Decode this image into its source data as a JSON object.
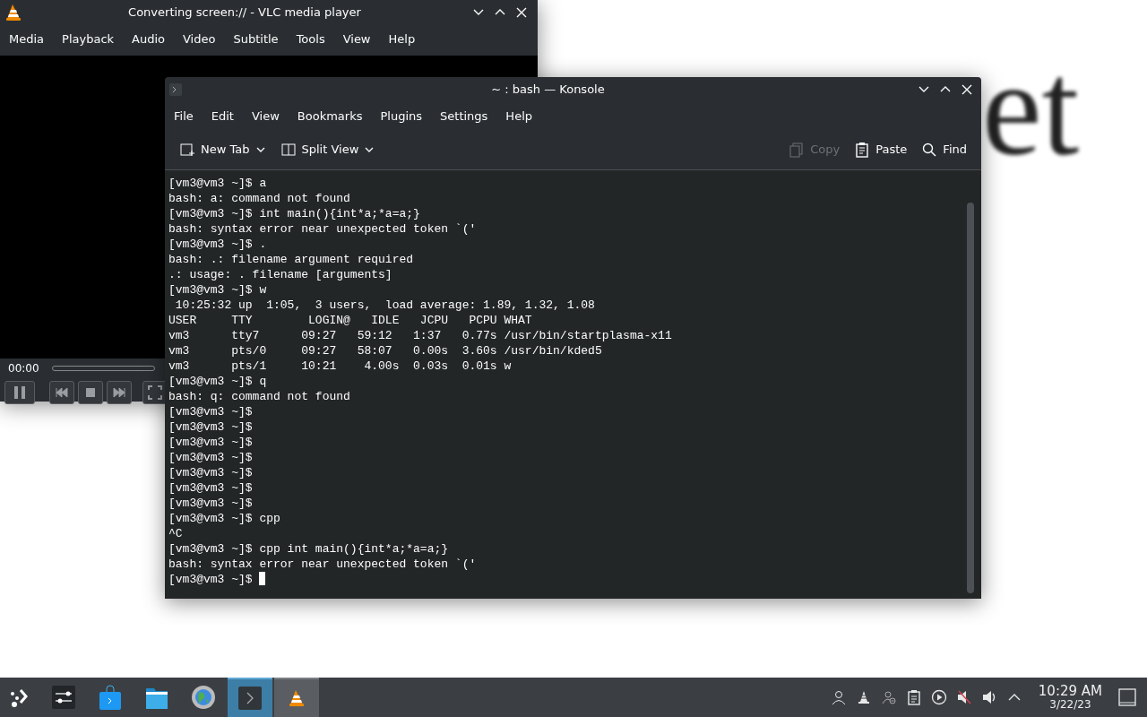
{
  "desktop": {
    "text": "et"
  },
  "vlc": {
    "title": "Converting screen:// - VLC media player",
    "menu": [
      "Media",
      "Playback",
      "Audio",
      "Video",
      "Subtitle",
      "Tools",
      "View",
      "Help"
    ],
    "time": "00:00"
  },
  "konsole": {
    "title": "~ : bash — Konsole",
    "menu": [
      "File",
      "Edit",
      "View",
      "Bookmarks",
      "Plugins",
      "Settings",
      "Help"
    ],
    "toolbar": [
      {
        "kind": "new-tab",
        "label": "New Tab",
        "disabled": false,
        "dropdown": true
      },
      {
        "kind": "split-view",
        "label": "Split View",
        "disabled": false,
        "dropdown": true
      },
      {
        "kind": "copy",
        "label": "Copy",
        "disabled": true,
        "dropdown": false
      },
      {
        "kind": "paste",
        "label": "Paste",
        "disabled": false,
        "dropdown": false
      },
      {
        "kind": "find",
        "label": "Find",
        "disabled": false,
        "dropdown": false
      }
    ],
    "lines": [
      "[vm3@vm3 ~]$ a",
      "bash: a: command not found",
      "[vm3@vm3 ~]$ int main(){int*a;*a=a;}",
      "bash: syntax error near unexpected token `('",
      "[vm3@vm3 ~]$ .",
      "bash: .: filename argument required",
      ".: usage: . filename [arguments]",
      "[vm3@vm3 ~]$ w",
      " 10:25:32 up  1:05,  3 users,  load average: 1.89, 1.32, 1.08",
      "USER     TTY        LOGIN@   IDLE   JCPU   PCPU WHAT",
      "vm3      tty7      09:27   59:12   1:37   0.77s /usr/bin/startplasma-x11",
      "vm3      pts/0     09:27   58:07   0.00s  3.60s /usr/bin/kded5",
      "vm3      pts/1     10:21    4.00s  0.03s  0.01s w",
      "[vm3@vm3 ~]$ q",
      "bash: q: command not found",
      "[vm3@vm3 ~]$",
      "[vm3@vm3 ~]$",
      "[vm3@vm3 ~]$",
      "[vm3@vm3 ~]$",
      "[vm3@vm3 ~]$",
      "[vm3@vm3 ~]$",
      "[vm3@vm3 ~]$",
      "[vm3@vm3 ~]$ cpp",
      "^C",
      "[vm3@vm3 ~]$ cpp int main(){int*a;*a=a;}",
      "bash: syntax error near unexpected token `('",
      "[vm3@vm3 ~]$ "
    ]
  },
  "taskbar": {
    "items": [
      {
        "kind": "launcher",
        "selected": false
      },
      {
        "kind": "mixer",
        "selected": false
      },
      {
        "kind": "store",
        "selected": false
      },
      {
        "kind": "files",
        "selected": false
      },
      {
        "kind": "browser",
        "selected": false
      },
      {
        "kind": "terminal",
        "selected": true
      },
      {
        "kind": "vlc",
        "selected": false
      }
    ],
    "tray": [
      {
        "kind": "user"
      },
      {
        "kind": "vlc"
      },
      {
        "kind": "user-status"
      },
      {
        "kind": "clipboard"
      },
      {
        "kind": "media"
      },
      {
        "kind": "muted"
      },
      {
        "kind": "volume"
      },
      {
        "kind": "expand"
      }
    ],
    "time": "10:29 AM",
    "date": "3/22/23"
  }
}
